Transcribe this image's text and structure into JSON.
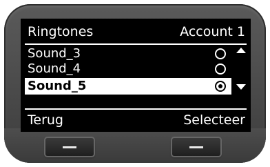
{
  "header": {
    "title": "Ringtones",
    "account": "Account 1"
  },
  "list": {
    "items": [
      {
        "label": "Sound_3",
        "selected": false,
        "highlighted": false
      },
      {
        "label": "Sound_4",
        "selected": false,
        "highlighted": false
      },
      {
        "label": "Sound_5",
        "selected": true,
        "highlighted": true
      }
    ]
  },
  "softkeys": {
    "left": "Terug",
    "right": "Selecteer"
  },
  "icons": {
    "scroll_up": "arrow-up-icon",
    "scroll_down": "arrow-down-icon",
    "radio_empty": "radio-unselected-icon",
    "radio_selected": "radio-selected-icon"
  },
  "colors": {
    "screen_bg": "#000000",
    "screen_fg": "#ffffff",
    "highlight_bg": "#ffffff",
    "bezel": "#4a4a4a"
  }
}
